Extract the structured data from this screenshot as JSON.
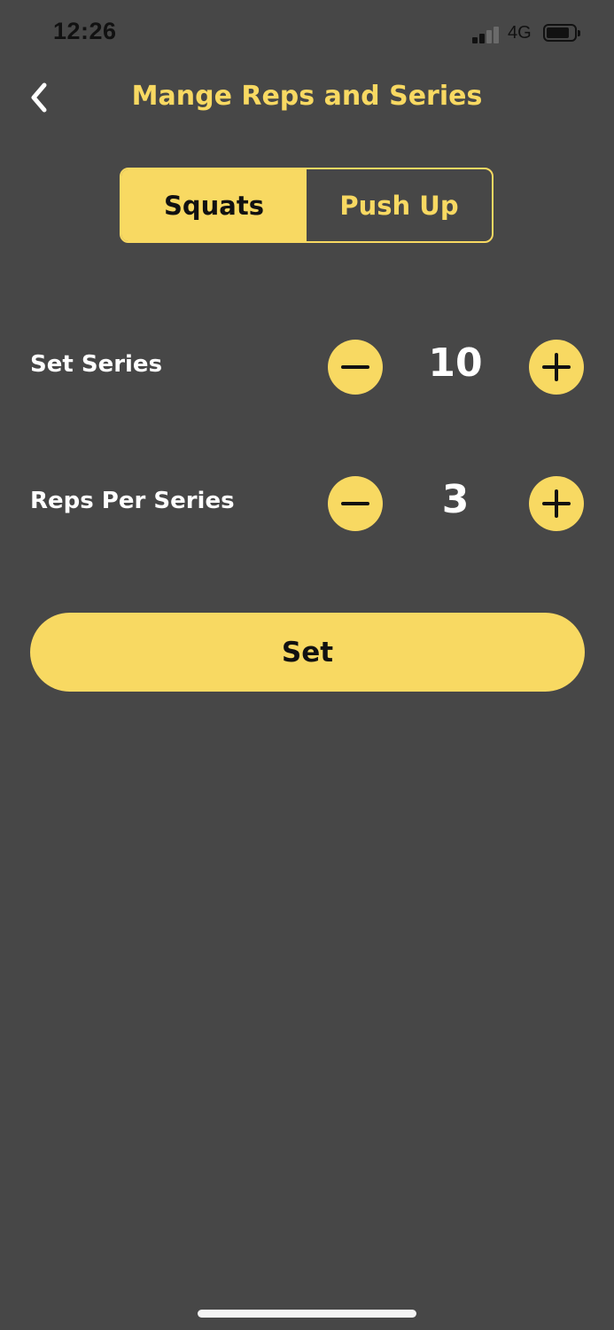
{
  "status_bar": {
    "time": "12:26",
    "network": "4G",
    "signal_bars_filled": 2,
    "signal_bars_total": 4,
    "battery_icon": "battery-icon",
    "signal_icon": "signal-icon"
  },
  "header": {
    "title": "Mange Reps and Series",
    "back_icon": "chevron-left-icon"
  },
  "segment": {
    "tabs": [
      {
        "label": "Squats",
        "selected": true
      },
      {
        "label": "Push Up",
        "selected": false
      }
    ]
  },
  "settings": {
    "series": {
      "label": "Set Series",
      "value": "10",
      "decrement_icon": "minus-icon",
      "increment_icon": "plus-icon"
    },
    "reps": {
      "label": "Reps Per Series",
      "value": "3",
      "decrement_icon": "minus-icon",
      "increment_icon": "plus-icon"
    }
  },
  "actions": {
    "set_label": "Set"
  },
  "colors": {
    "background": "#474747",
    "accent": "#f8d962",
    "text": "#ffffff",
    "dark_text": "#111111"
  }
}
